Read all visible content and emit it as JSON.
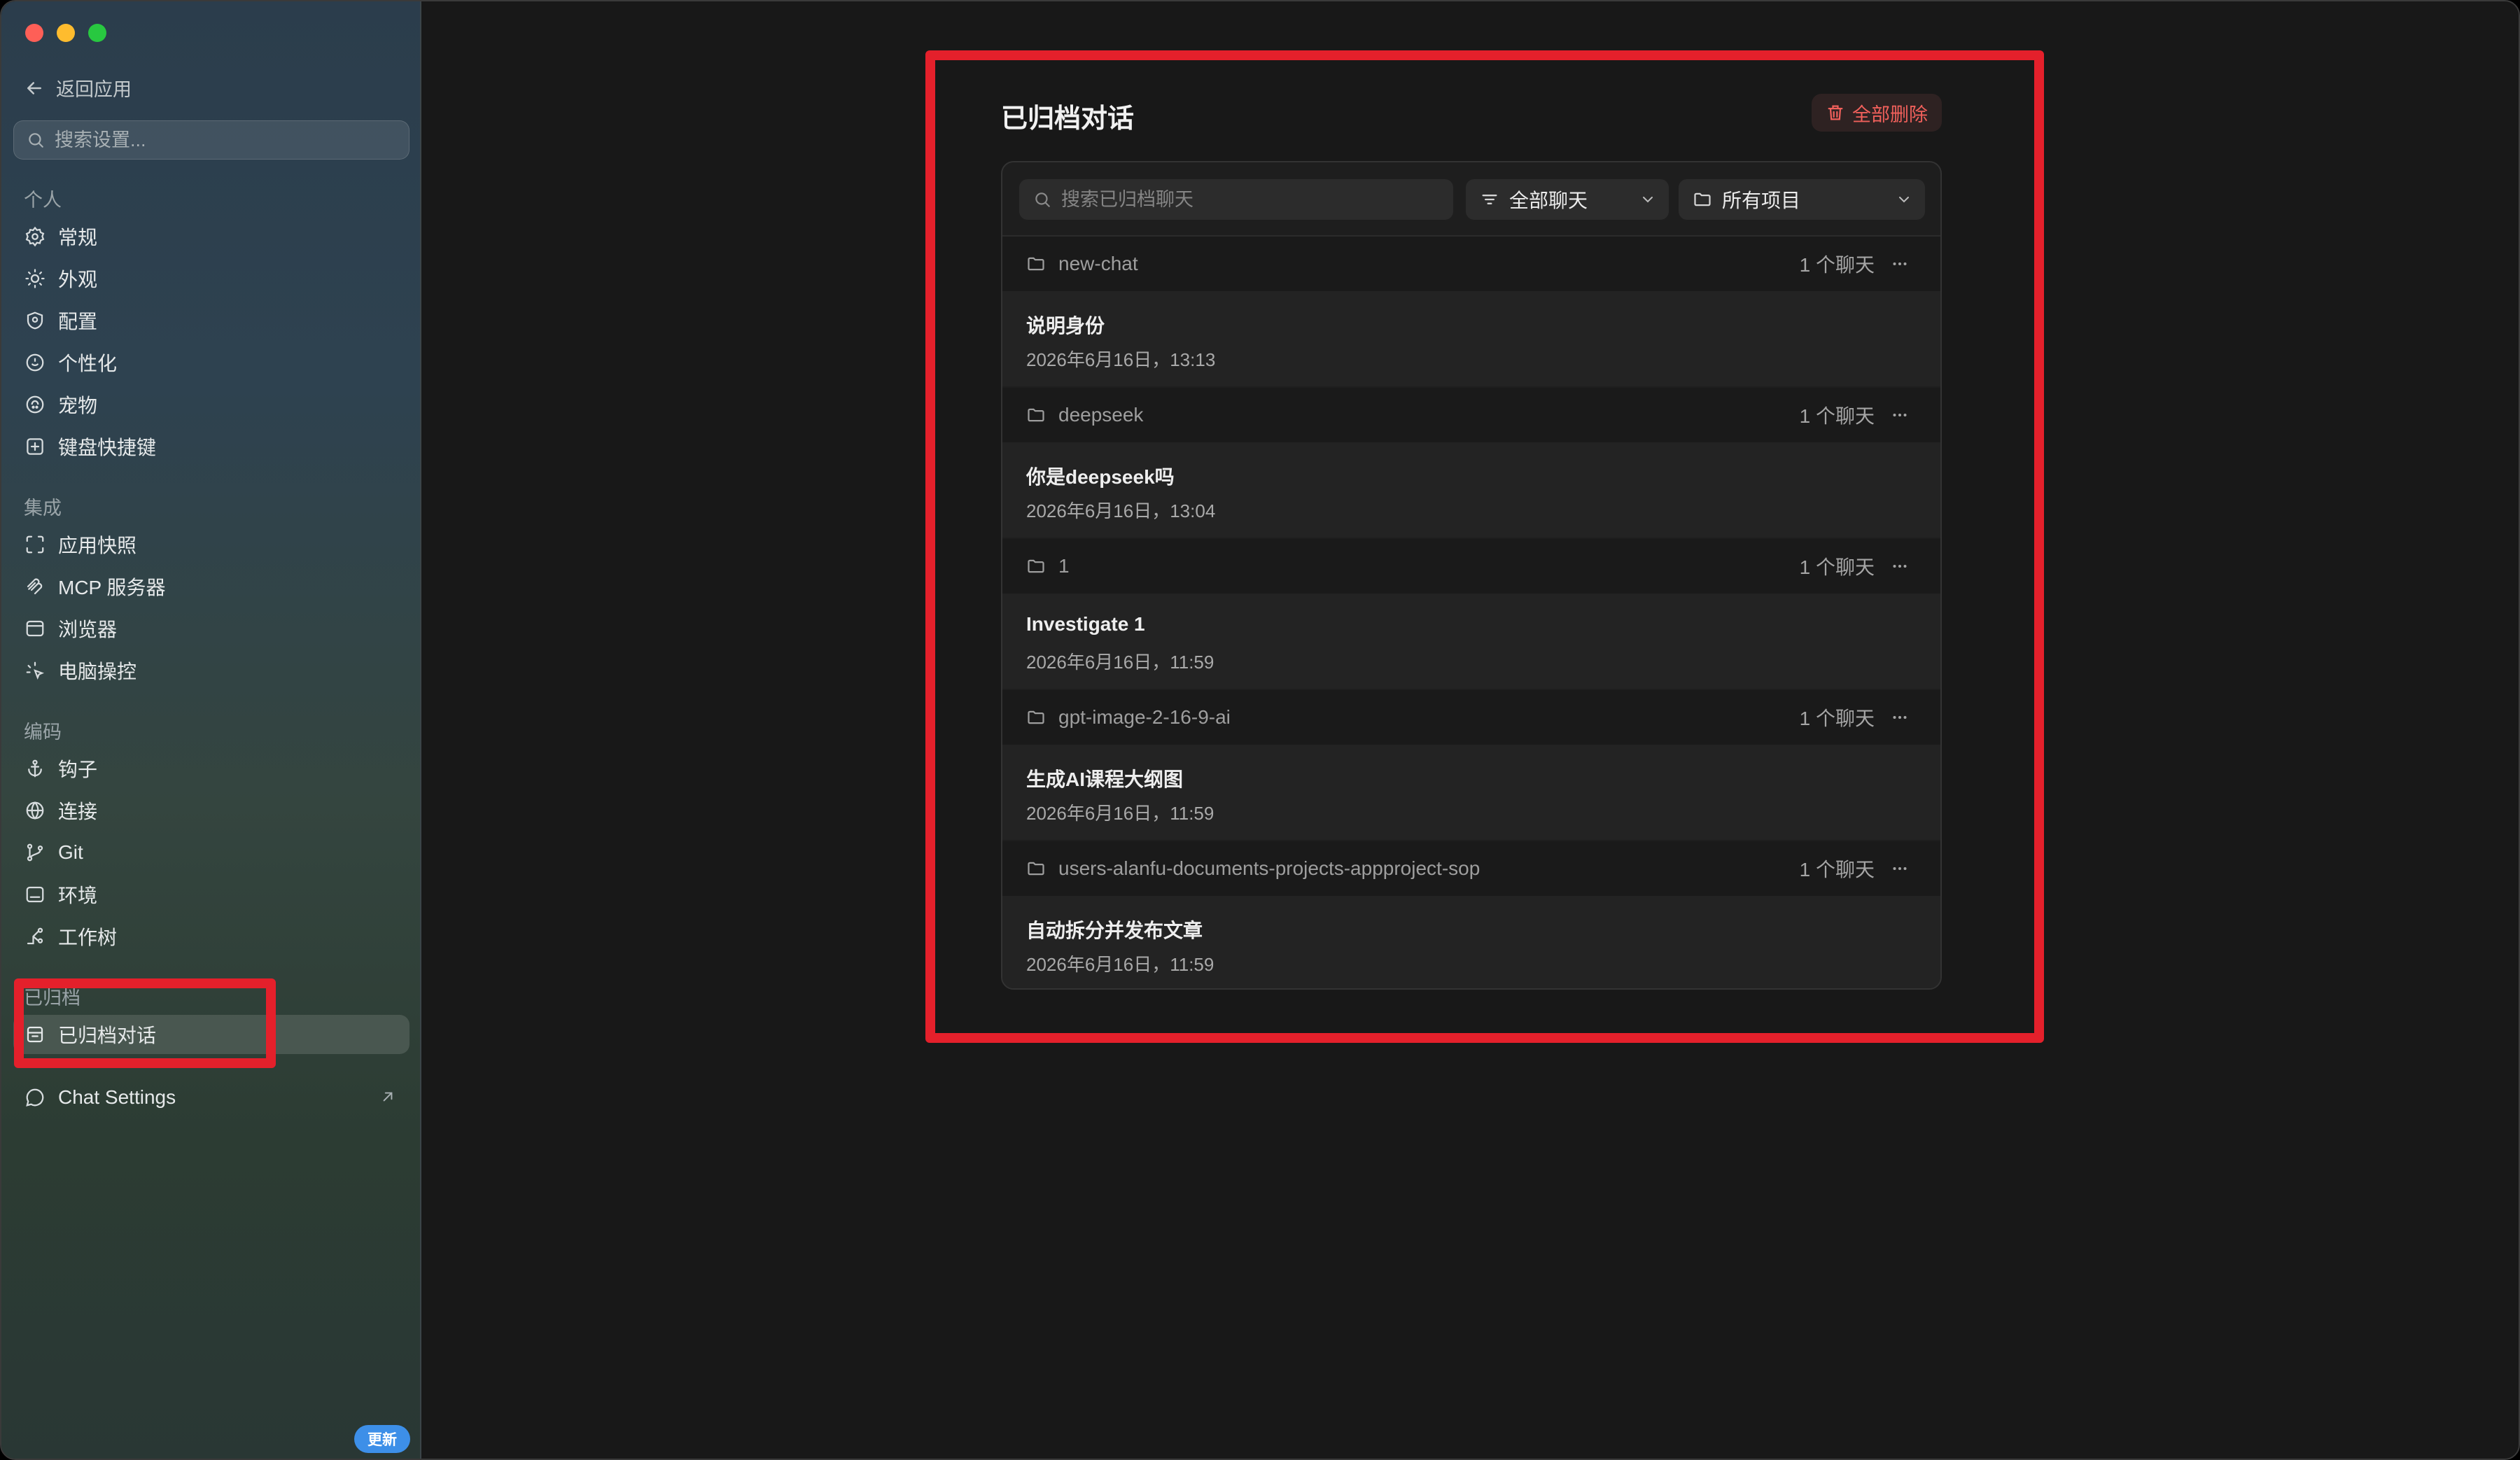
{
  "sidebar": {
    "back_label": "返回应用",
    "search_placeholder": "搜索设置...",
    "sections": {
      "personal": "个人",
      "integrations": "集成",
      "coding": "编码",
      "archived": "已归档"
    },
    "items": {
      "general": "常规",
      "appearance": "外观",
      "config": "配置",
      "personalization": "个性化",
      "pets": "宠物",
      "shortcuts": "键盘快捷键",
      "app_snapshot": "应用快照",
      "mcp": "MCP 服务器",
      "browser": "浏览器",
      "computer_control": "电脑操控",
      "hooks": "钩子",
      "connections": "连接",
      "git": "Git",
      "environment": "环境",
      "worktree": "工作树",
      "archived_chats": "已归档对话",
      "chat_settings": "Chat Settings"
    },
    "update_badge": "更新"
  },
  "main": {
    "title": "已归档对话",
    "delete_all": "全部删除",
    "search_placeholder": "搜索已归档聊天",
    "filter_chats": "全部聊天",
    "filter_projects": "所有项目",
    "groups": [
      {
        "folder": "new-chat",
        "count": "1 个聊天",
        "chat_title": "说明身份",
        "chat_time": "2026年6月16日，13:13"
      },
      {
        "folder": "deepseek",
        "count": "1 个聊天",
        "chat_title": "你是deepseek吗",
        "chat_time": "2026年6月16日，13:04"
      },
      {
        "folder": "1",
        "count": "1 个聊天",
        "chat_title": "Investigate 1",
        "chat_time": "2026年6月16日，11:59"
      },
      {
        "folder": "gpt-image-2-16-9-ai",
        "count": "1 个聊天",
        "chat_title": "生成AI课程大纲图",
        "chat_time": "2026年6月16日，11:59"
      },
      {
        "folder": "users-alanfu-documents-projects-appproject-sop",
        "count": "1 个聊天",
        "chat_title": "自动拆分并发布文章",
        "chat_time": "2026年6月16日，11:59"
      }
    ]
  },
  "colors": {
    "accent_red": "#e4202b",
    "delete_red": "#f0605b",
    "update_blue": "#3d8fe8"
  }
}
